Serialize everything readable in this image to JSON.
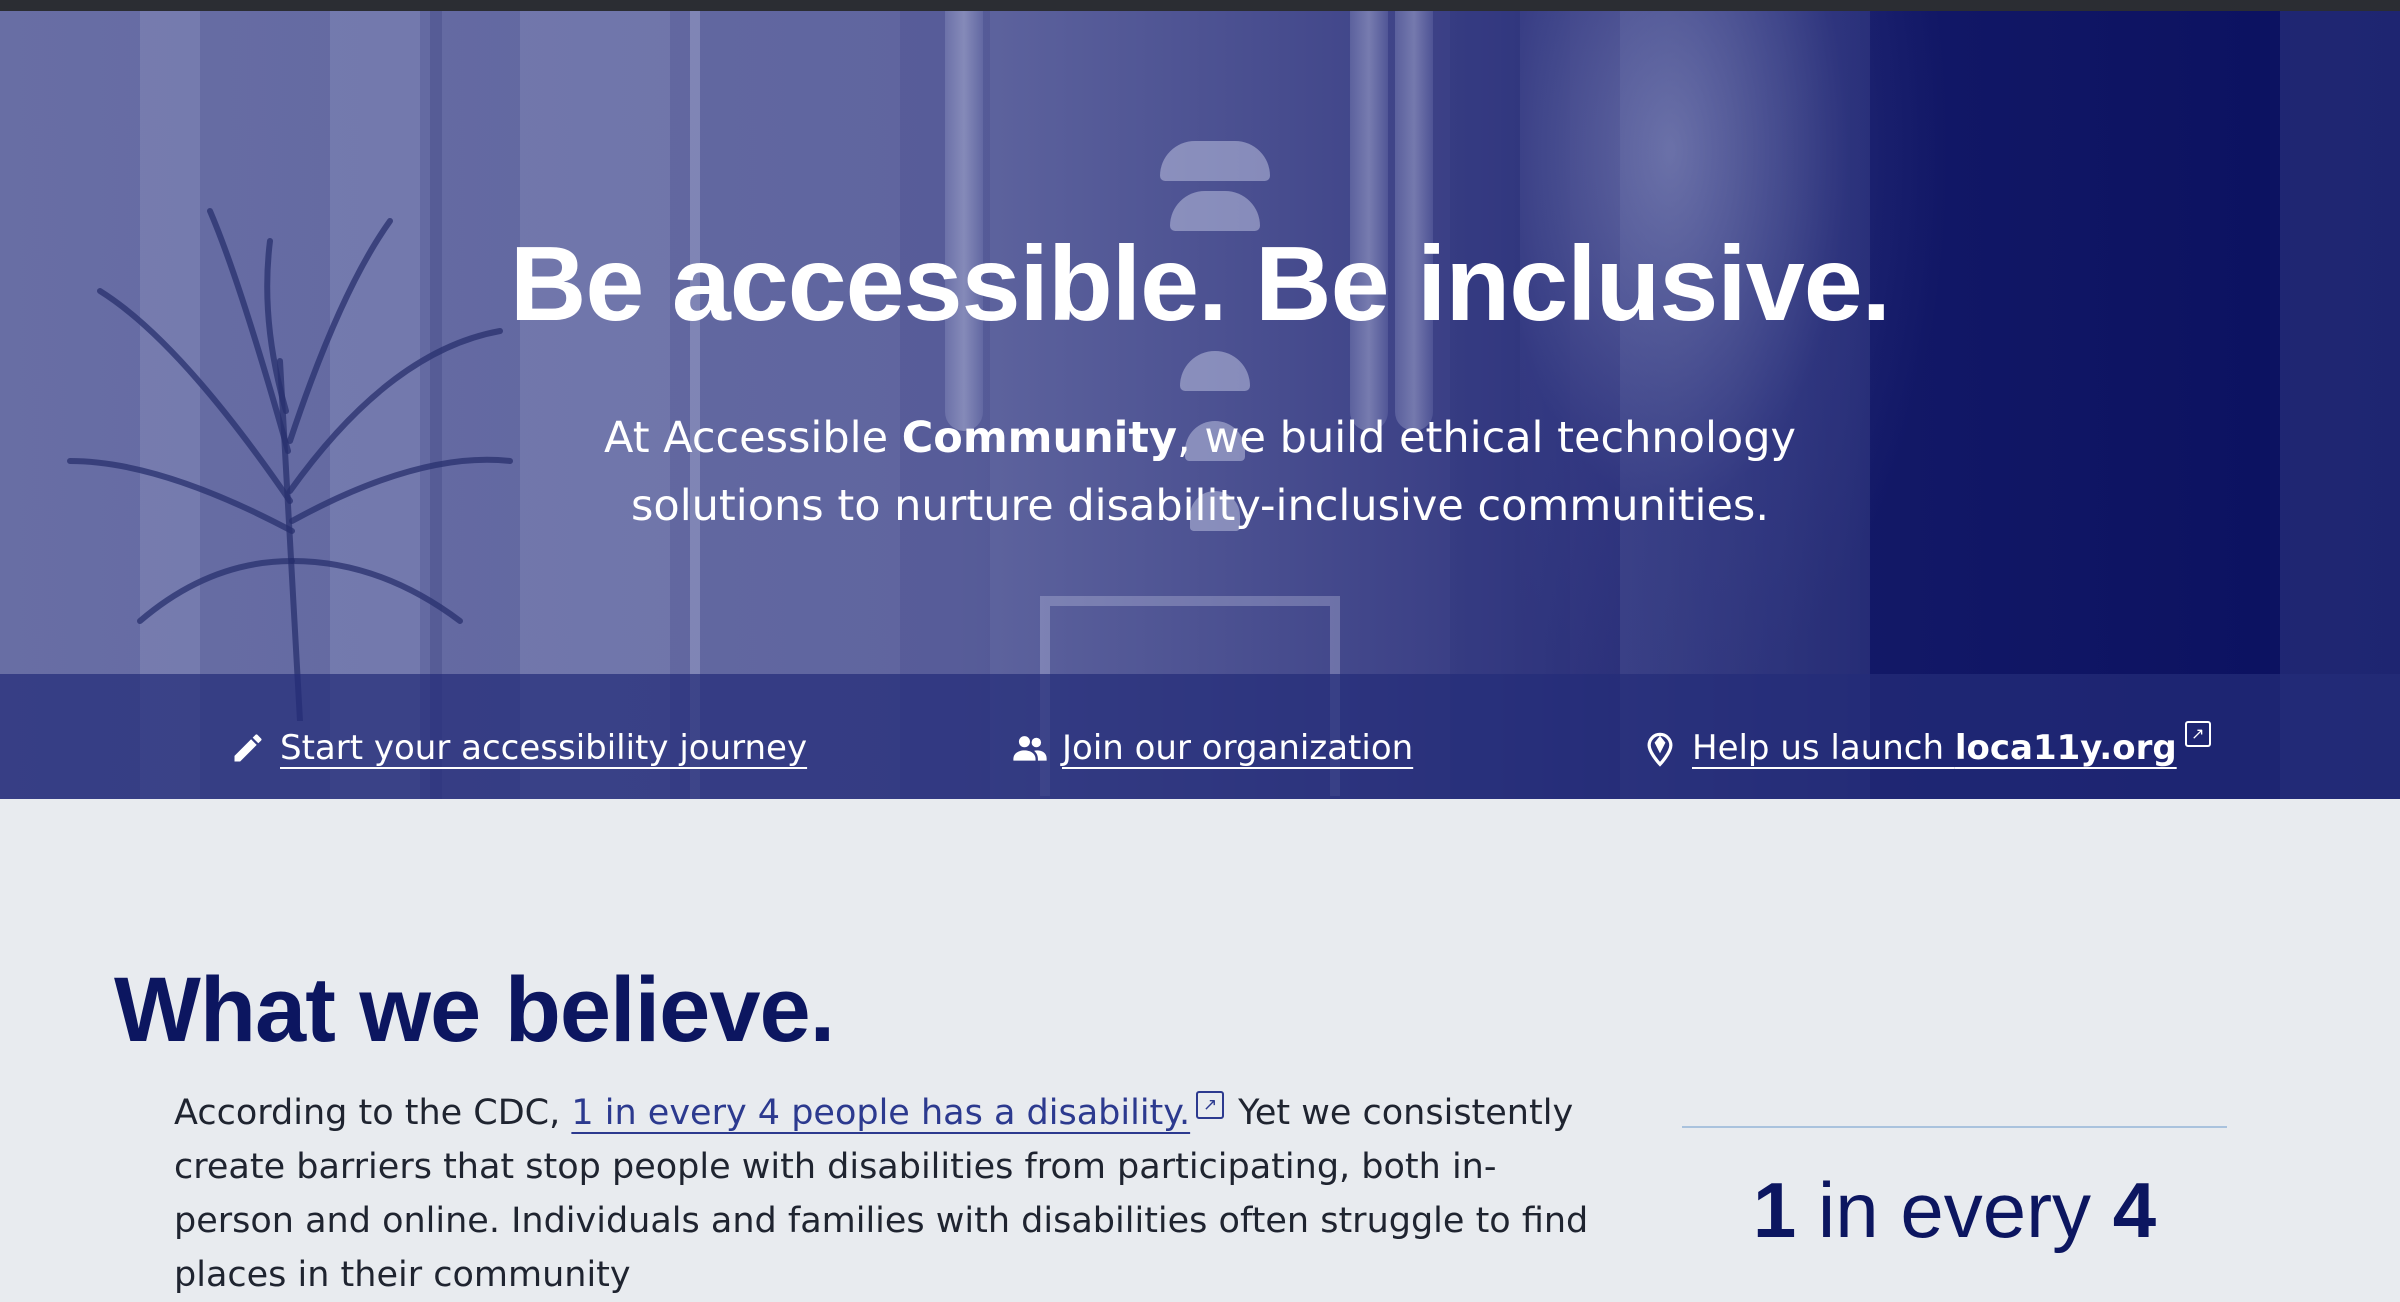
{
  "hero": {
    "title_part1": "Be ",
    "title_bold1": "accessible",
    "title_part2": ". Be ",
    "title_bold2": "inclusive",
    "title_part3": ".",
    "subtitle_part1": "At Accessible ",
    "subtitle_bold": "Community",
    "subtitle_part2": ", we build ethical technology",
    "subtitle_line2": "solutions to nurture disability-inclusive communities."
  },
  "actions": [
    {
      "icon": "pencil-icon",
      "label": "Start your accessibility journey"
    },
    {
      "icon": "people-icon",
      "label": "Join our organization"
    },
    {
      "icon": "map-pin-icon",
      "label_prefix": "Help us launch ",
      "label_bold": "loca11y.org",
      "external": true
    }
  ],
  "believe": {
    "title_part1": "What we ",
    "title_bold": "believe",
    "title_part2": ".",
    "text_before_link": "According to the CDC, ",
    "link_text": "1 in every 4 people has a disability.",
    "text_after_link": "Yet we consistently create barriers that stop people with disabilities from participating, both in-person and online. Individuals and families with disabilities often struggle to find places in their community"
  },
  "stat": {
    "num1": "1",
    "middle": " in every ",
    "num2": "4"
  },
  "colors": {
    "navy": "#0c1660",
    "link": "#2c3a8f",
    "page_bg": "#e8ebef",
    "rule": "#a9c2dd"
  }
}
